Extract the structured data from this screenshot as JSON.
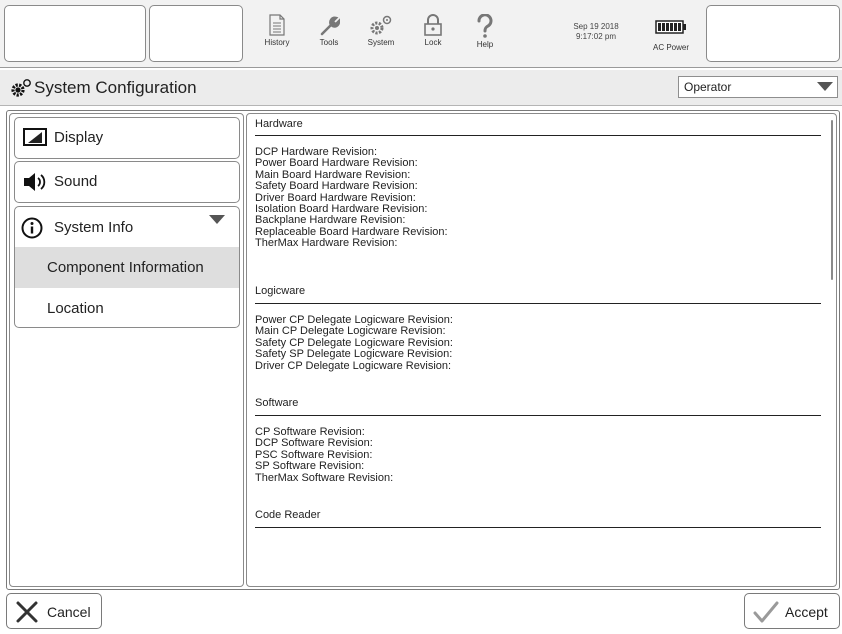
{
  "toolbar": {
    "tools": [
      {
        "label": "History",
        "icon": "history-icon"
      },
      {
        "label": "Tools",
        "icon": "wrench-icon"
      },
      {
        "label": "System",
        "icon": "gears-icon"
      },
      {
        "label": "Lock",
        "icon": "lock-icon"
      },
      {
        "label": "Help",
        "icon": "question-icon"
      }
    ],
    "date": "Sep 19 2018",
    "time": "9:17:02 pm",
    "power_label": "AC Power"
  },
  "header": {
    "title": "System Configuration",
    "role_select": "Operator"
  },
  "nav": {
    "display": "Display",
    "sound": "Sound",
    "system_info": "System Info",
    "component_information": "Component Information",
    "location": "Location"
  },
  "content": {
    "hardware": {
      "title": "Hardware",
      "lines": [
        "DCP Hardware Revision:",
        "Power Board Hardware Revision:",
        "Main Board Hardware Revision:",
        "Safety Board Hardware Revision:",
        "Driver Board Hardware Revision:",
        "Isolation Board Hardware Revision:",
        "Backplane Hardware Revision:",
        "Replaceable Board Hardware Revision:",
        "TherMax Hardware Revision:"
      ]
    },
    "logicware": {
      "title": "Logicware",
      "lines": [
        "Power CP Delegate Logicware Revision:",
        "Main CP Delegate Logicware Revision:",
        "Safety CP Delegate Logicware Revision:",
        "Safety SP Delegate Logicware Revision:",
        "Driver CP Delegate Logicware Revision:"
      ]
    },
    "software": {
      "title": "Software",
      "lines": [
        "CP Software Revision:",
        "DCP Software Revision:",
        "PSC Software Revision:",
        "SP Software Revision:",
        "TherMax Software Revision:"
      ]
    },
    "code_reader": {
      "title": "Code Reader"
    }
  },
  "footer": {
    "cancel": "Cancel",
    "accept": "Accept"
  },
  "colors": {
    "toolbar_bg": "#f2f2f2",
    "selected_bg": "#dedede",
    "accept_check": "#9a9a9a"
  }
}
